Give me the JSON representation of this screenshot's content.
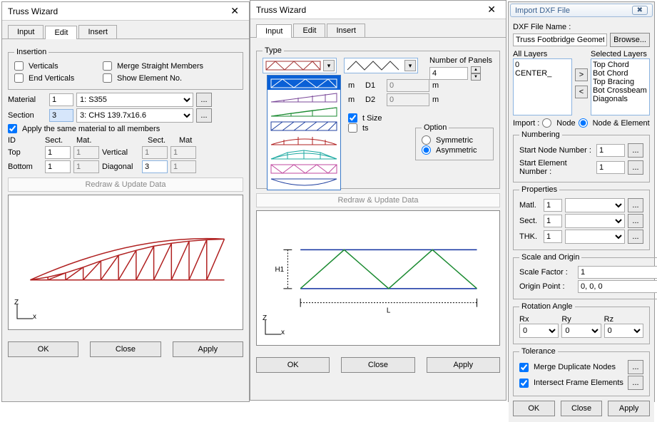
{
  "dialog1": {
    "title": "Truss Wizard",
    "tabs": [
      "Input",
      "Edit",
      "Insert"
    ],
    "active_tab": "Edit",
    "insertion": {
      "legend": "Insertion",
      "verticals_label": "Verticals",
      "end_verticals_label": "End Verticals",
      "merge_label": "Merge Straight Members",
      "show_label": "Show Element No.",
      "verticals": false,
      "end_verticals": false,
      "merge": false,
      "show": false
    },
    "material": {
      "label": "Material",
      "id": "1",
      "select": "1: S355"
    },
    "section": {
      "label": "Section",
      "id": "3",
      "select": "3: CHS 139.7x16.6"
    },
    "apply_same_label": "Apply the same material to all members",
    "apply_same": true,
    "headers": {
      "id": "ID",
      "sect": "Sect.",
      "mat": "Mat."
    },
    "top": {
      "label": "Top",
      "sect": "1",
      "mat": "1"
    },
    "bottom": {
      "label": "Bottom",
      "sect": "1",
      "mat": "1"
    },
    "vertical": {
      "label": "Vertical",
      "sect": "1",
      "mat": "1"
    },
    "diagonal": {
      "label": "Diagonal",
      "sect": "3",
      "mat": "1"
    },
    "redraw": "Redraw & Update Data",
    "axis_z": "Z",
    "axis_x": "x",
    "ok": "OK",
    "close": "Close",
    "apply": "Apply"
  },
  "dialog2": {
    "title": "Truss Wizard",
    "tabs": [
      "Input",
      "Edit",
      "Insert"
    ],
    "active_tab": "Input",
    "type_legend": "Type",
    "num_panels_label": "Number of Panels",
    "num_panels": "4",
    "dims": {
      "m": "m",
      "d1_label": "D1",
      "d2_label": "D2",
      "d1": "0",
      "d2": "0"
    },
    "t_size_label": "t Size",
    "ts_label": "ts",
    "option": {
      "legend": "Option",
      "symmetric": "Symmetric",
      "asymmetric": "Asymmetric",
      "selected": "Asymmetric"
    },
    "redraw": "Redraw & Update Data",
    "preview_h": "H1",
    "preview_l": "L",
    "axis_z": "Z",
    "axis_x": "x",
    "ok": "OK",
    "close": "Close",
    "apply": "Apply"
  },
  "dialog3": {
    "title": "Import DXF File",
    "file_label": "DXF File Name :",
    "file": "Truss Footbridge Geometry.dxf",
    "browse": "Browse...",
    "all_layers_label": "All Layers",
    "selected_layers_label": "Selected Layers",
    "all_layers": [
      "0",
      "CENTER_"
    ],
    "selected_layers": [
      "Top Chord",
      "Bot Chord",
      "Top Bracing",
      "Bot Crossbeam",
      "Diagonals"
    ],
    "move_right": ">",
    "move_left": "<",
    "import_label": "Import :",
    "import_node": "Node",
    "import_node_elem": "Node & Element",
    "import_selected": "Node & Element",
    "numbering": {
      "legend": "Numbering",
      "start_node_label": "Start Node Number  :",
      "start_node": "1",
      "start_elem_label": "Start Element Number  :",
      "start_elem": "1"
    },
    "properties": {
      "legend": "Properties",
      "matl_label": "Matl.",
      "matl": "1",
      "sect_label": "Sect.",
      "sect": "1",
      "thk_label": "THK.",
      "thk": "1"
    },
    "scale": {
      "legend": "Scale and Origin",
      "scale_label": "Scale Factor  :",
      "scale": "1",
      "origin_label": "Origin  Point  :",
      "origin": "0, 0, 0"
    },
    "rotation": {
      "legend": "Rotation Angle",
      "rx_label": "Rx",
      "ry_label": "Ry",
      "rz_label": "Rz",
      "rx": "0",
      "ry": "0",
      "rz": "0"
    },
    "tolerance": {
      "legend": "Tolerance",
      "merge_label": "Merge Duplicate Nodes",
      "merge": true,
      "intersect_label": "Intersect Frame Elements",
      "intersect": true
    },
    "ok": "OK",
    "close": "Close",
    "apply": "Apply"
  }
}
